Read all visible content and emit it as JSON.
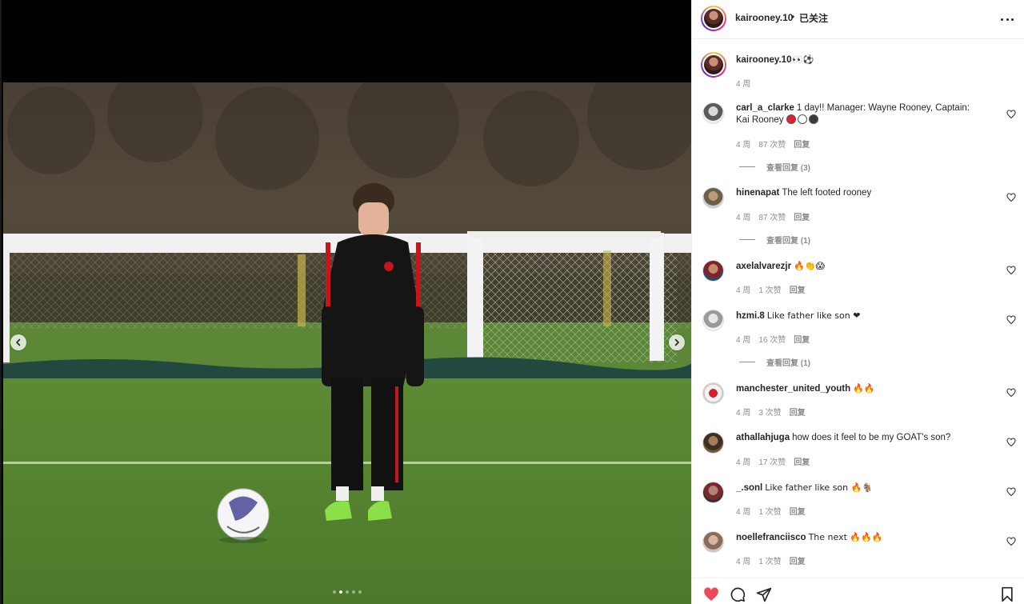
{
  "post": {
    "username": "kairooney.10",
    "separator": "•",
    "follow_status": "已关注",
    "caption_emoji": "👀⚽",
    "caption_time": "4 周"
  },
  "carousel": {
    "slide_count": 5,
    "active_index": 1
  },
  "comments": [
    {
      "user": "carl_a_clarke",
      "text": "1 day!! Manager: Wayne Rooney, Captain: Kai Rooney",
      "dots": [
        "#e0212b",
        "#ffffff",
        "#3a3a3a"
      ],
      "time": "4 周",
      "likes": "87 次赞",
      "reply": "回复",
      "view_replies": "查看回复 (3)"
    },
    {
      "user": "hinenapat",
      "text": "The left footed rooney",
      "time": "4 周",
      "likes": "87 次赞",
      "reply": "回复",
      "view_replies": "查看回复 (1)"
    },
    {
      "user": "axelalvarezjr",
      "text": "🔥👏😱",
      "time": "4 周",
      "likes": "1 次赞",
      "reply": "回复"
    },
    {
      "user": "hzmi.8",
      "text": "Like father like son ❤",
      "time": "4 周",
      "likes": "16 次赞",
      "reply": "回复",
      "view_replies": "查看回复 (1)"
    },
    {
      "user": "manchester_united_youth",
      "text": "🔥🔥",
      "time": "4 周",
      "likes": "3 次赞",
      "reply": "回复"
    },
    {
      "user": "athallahjuga",
      "text": "how does it feel to be my GOAT's son?",
      "time": "4 周",
      "likes": "17 次赞",
      "reply": "回复"
    },
    {
      "user": "_.sonl",
      "text": "Like father like son 🔥🐐",
      "time": "4 周",
      "likes": "1 次赞",
      "reply": "回复"
    },
    {
      "user": "noellefranciisco",
      "text": "The next 🔥🔥🔥",
      "time": "4 周",
      "likes": "1 次赞",
      "reply": "回复"
    }
  ],
  "colors": {
    "heart_liked": "#ed4956",
    "text": "#262626",
    "muted": "#8e8e8e",
    "border": "#efefef"
  },
  "icons": [
    "chevron-left-icon",
    "chevron-right-icon",
    "more-icon",
    "heart-icon",
    "comment-icon",
    "share-icon",
    "bookmark-icon"
  ]
}
